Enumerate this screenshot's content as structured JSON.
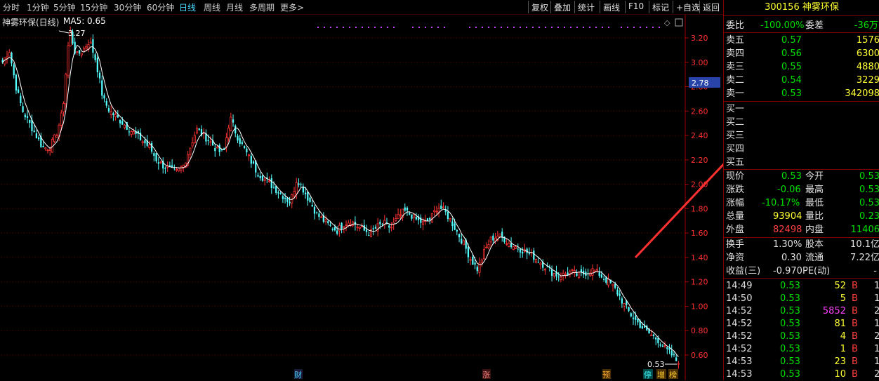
{
  "toolbar": {
    "periods": [
      "分时",
      "1分钟",
      "5分钟",
      "15分钟",
      "30分钟",
      "60分钟",
      "日线",
      "周线",
      "月线",
      "多周期",
      "更多>"
    ],
    "active_period": "日线",
    "tools": [
      "复权",
      "叠加",
      "统计",
      "画线",
      "F10",
      "标记",
      "+自选",
      "返回"
    ]
  },
  "chart": {
    "title": "神雾环保(日线)",
    "ma_label": "MA5: 0.65",
    "high_label": "3.27",
    "low_label": "0.53",
    "current_price_tag": "2.78",
    "event_markers": [
      "财",
      "涨",
      "预",
      "停",
      "增",
      "榜"
    ]
  },
  "chart_data": {
    "type": "candlestick",
    "ylim": [
      0.55,
      3.3
    ],
    "yticks": [
      3.2,
      3.0,
      2.8,
      2.6,
      2.4,
      2.2,
      2.0,
      1.8,
      1.6,
      1.4,
      1.2,
      1.0,
      0.8,
      0.6
    ],
    "close_path": [
      3.0,
      3.1,
      2.8,
      2.6,
      2.5,
      2.4,
      2.3,
      2.3,
      2.4,
      2.6,
      3.27,
      3.05,
      3.1,
      3.18,
      3.0,
      2.7,
      2.6,
      2.55,
      2.5,
      2.45,
      2.4,
      2.35,
      2.3,
      2.2,
      2.15,
      2.12,
      2.1,
      2.15,
      2.3,
      2.45,
      2.4,
      2.35,
      2.28,
      2.25,
      2.55,
      2.4,
      2.3,
      2.2,
      2.1,
      2.05,
      2.0,
      1.95,
      1.9,
      1.85,
      2.05,
      1.95,
      1.85,
      1.75,
      1.7,
      1.65,
      1.62,
      1.68,
      1.7,
      1.66,
      1.62,
      1.6,
      1.65,
      1.68,
      1.64,
      1.72,
      1.78,
      1.75,
      1.7,
      1.68,
      1.72,
      1.82,
      1.78,
      1.7,
      1.6,
      1.5,
      1.38,
      1.3,
      1.45,
      1.55,
      1.58,
      1.55,
      1.5,
      1.48,
      1.45,
      1.42,
      1.38,
      1.33,
      1.28,
      1.25,
      1.26,
      1.28,
      1.25,
      1.27,
      1.3,
      1.27,
      1.22,
      1.18,
      1.1,
      1.0,
      0.92,
      0.86,
      0.8,
      0.76,
      0.72,
      0.65,
      0.6,
      0.53
    ]
  },
  "quote": {
    "code": "300156",
    "name": "神雾环保",
    "order_ratio_label": "委比",
    "order_ratio_value": "-100.00%",
    "order_diff_label": "委差",
    "order_diff_value": "-36万",
    "asks": [
      {
        "label": "卖五",
        "price": "0.57",
        "vol": "1576"
      },
      {
        "label": "卖四",
        "price": "0.56",
        "vol": "6300"
      },
      {
        "label": "卖三",
        "price": "0.55",
        "vol": "4880"
      },
      {
        "label": "卖二",
        "price": "0.54",
        "vol": "3229"
      },
      {
        "label": "卖一",
        "price": "0.53",
        "vol": "342098"
      }
    ],
    "bids": [
      {
        "label": "买一"
      },
      {
        "label": "买二"
      },
      {
        "label": "买三"
      },
      {
        "label": "买四"
      },
      {
        "label": "买五"
      }
    ],
    "stats": [
      {
        "l1": "现价",
        "v1": "0.53",
        "l2": "今开",
        "v2": "0.53"
      },
      {
        "l1": "涨跌",
        "v1": "-0.06",
        "l2": "最高",
        "v2": "0.53"
      },
      {
        "l1": "涨幅",
        "v1": "-10.17%",
        "l2": "最低",
        "v2": "0.53"
      },
      {
        "l1": "总量",
        "v1": "93904",
        "l2": "量比",
        "v2": "0.23"
      },
      {
        "l1": "外盘",
        "v1": "82498",
        "l2": "内盘",
        "v2": "11406"
      }
    ],
    "fundamentals": [
      {
        "l1": "换手",
        "v1": "1.30%",
        "l2": "股本",
        "v2": "10.1亿"
      },
      {
        "l1": "净资",
        "v1": "0.30",
        "l2": "流通",
        "v2": "7.22亿"
      },
      {
        "l1": "收益(三)",
        "v1": "-0.970",
        "l2": "PE(动)",
        "v2": "-"
      }
    ],
    "ticks": [
      {
        "time": "14:49",
        "price": "0.53",
        "vol": "52",
        "side": "B",
        "extra": "1"
      },
      {
        "time": "14:50",
        "price": "0.53",
        "vol": "5",
        "side": "B",
        "extra": "1"
      },
      {
        "time": "14:52",
        "price": "0.53",
        "vol": "5852",
        "side": "B",
        "extra": "2"
      },
      {
        "time": "14:52",
        "price": "0.53",
        "vol": "81",
        "side": "B",
        "extra": "1"
      },
      {
        "time": "14:52",
        "price": "0.53",
        "vol": "4",
        "side": "B",
        "extra": "2"
      },
      {
        "time": "14:52",
        "price": "0.53",
        "vol": "1",
        "side": "B",
        "extra": "1"
      },
      {
        "time": "14:53",
        "price": "0.53",
        "vol": "23",
        "side": "B",
        "extra": "1"
      },
      {
        "time": "14:53",
        "price": "0.53",
        "vol": "10",
        "side": "B",
        "extra": "2"
      }
    ]
  },
  "colors": {
    "up": "#ff3333",
    "down": "#54ffff",
    "ma": "#ffffff",
    "grid": "#6a0000",
    "arrow": "#ff3030"
  }
}
